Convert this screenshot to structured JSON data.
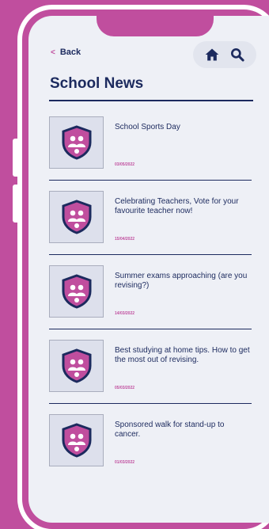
{
  "nav": {
    "back_label": "Back",
    "back_icon": "chevron-left-icon",
    "home_icon": "home-icon",
    "search_icon": "search-icon"
  },
  "page": {
    "title": "School News"
  },
  "news": [
    {
      "title": "School Sports Day",
      "date": "03/05/2022",
      "icon": "school-shield-icon"
    },
    {
      "title": "Celebrating Teachers, Vote for your favourite teacher now!",
      "date": "15/04/2022",
      "icon": "school-shield-icon"
    },
    {
      "title": "Summer exams approaching (are you revising?)",
      "date": "14/03/2022",
      "icon": "school-shield-icon"
    },
    {
      "title": "Best studying at home tips. How to get the most out of revising.",
      "date": "05/03/2022",
      "icon": "school-shield-icon"
    },
    {
      "title": "Sponsored walk for stand-up to cancer.",
      "date": "01/03/2022",
      "icon": "school-shield-icon"
    }
  ],
  "colors": {
    "brand": "#c04e9e",
    "navy": "#1c2a5e",
    "screen": "#eef0f6"
  }
}
